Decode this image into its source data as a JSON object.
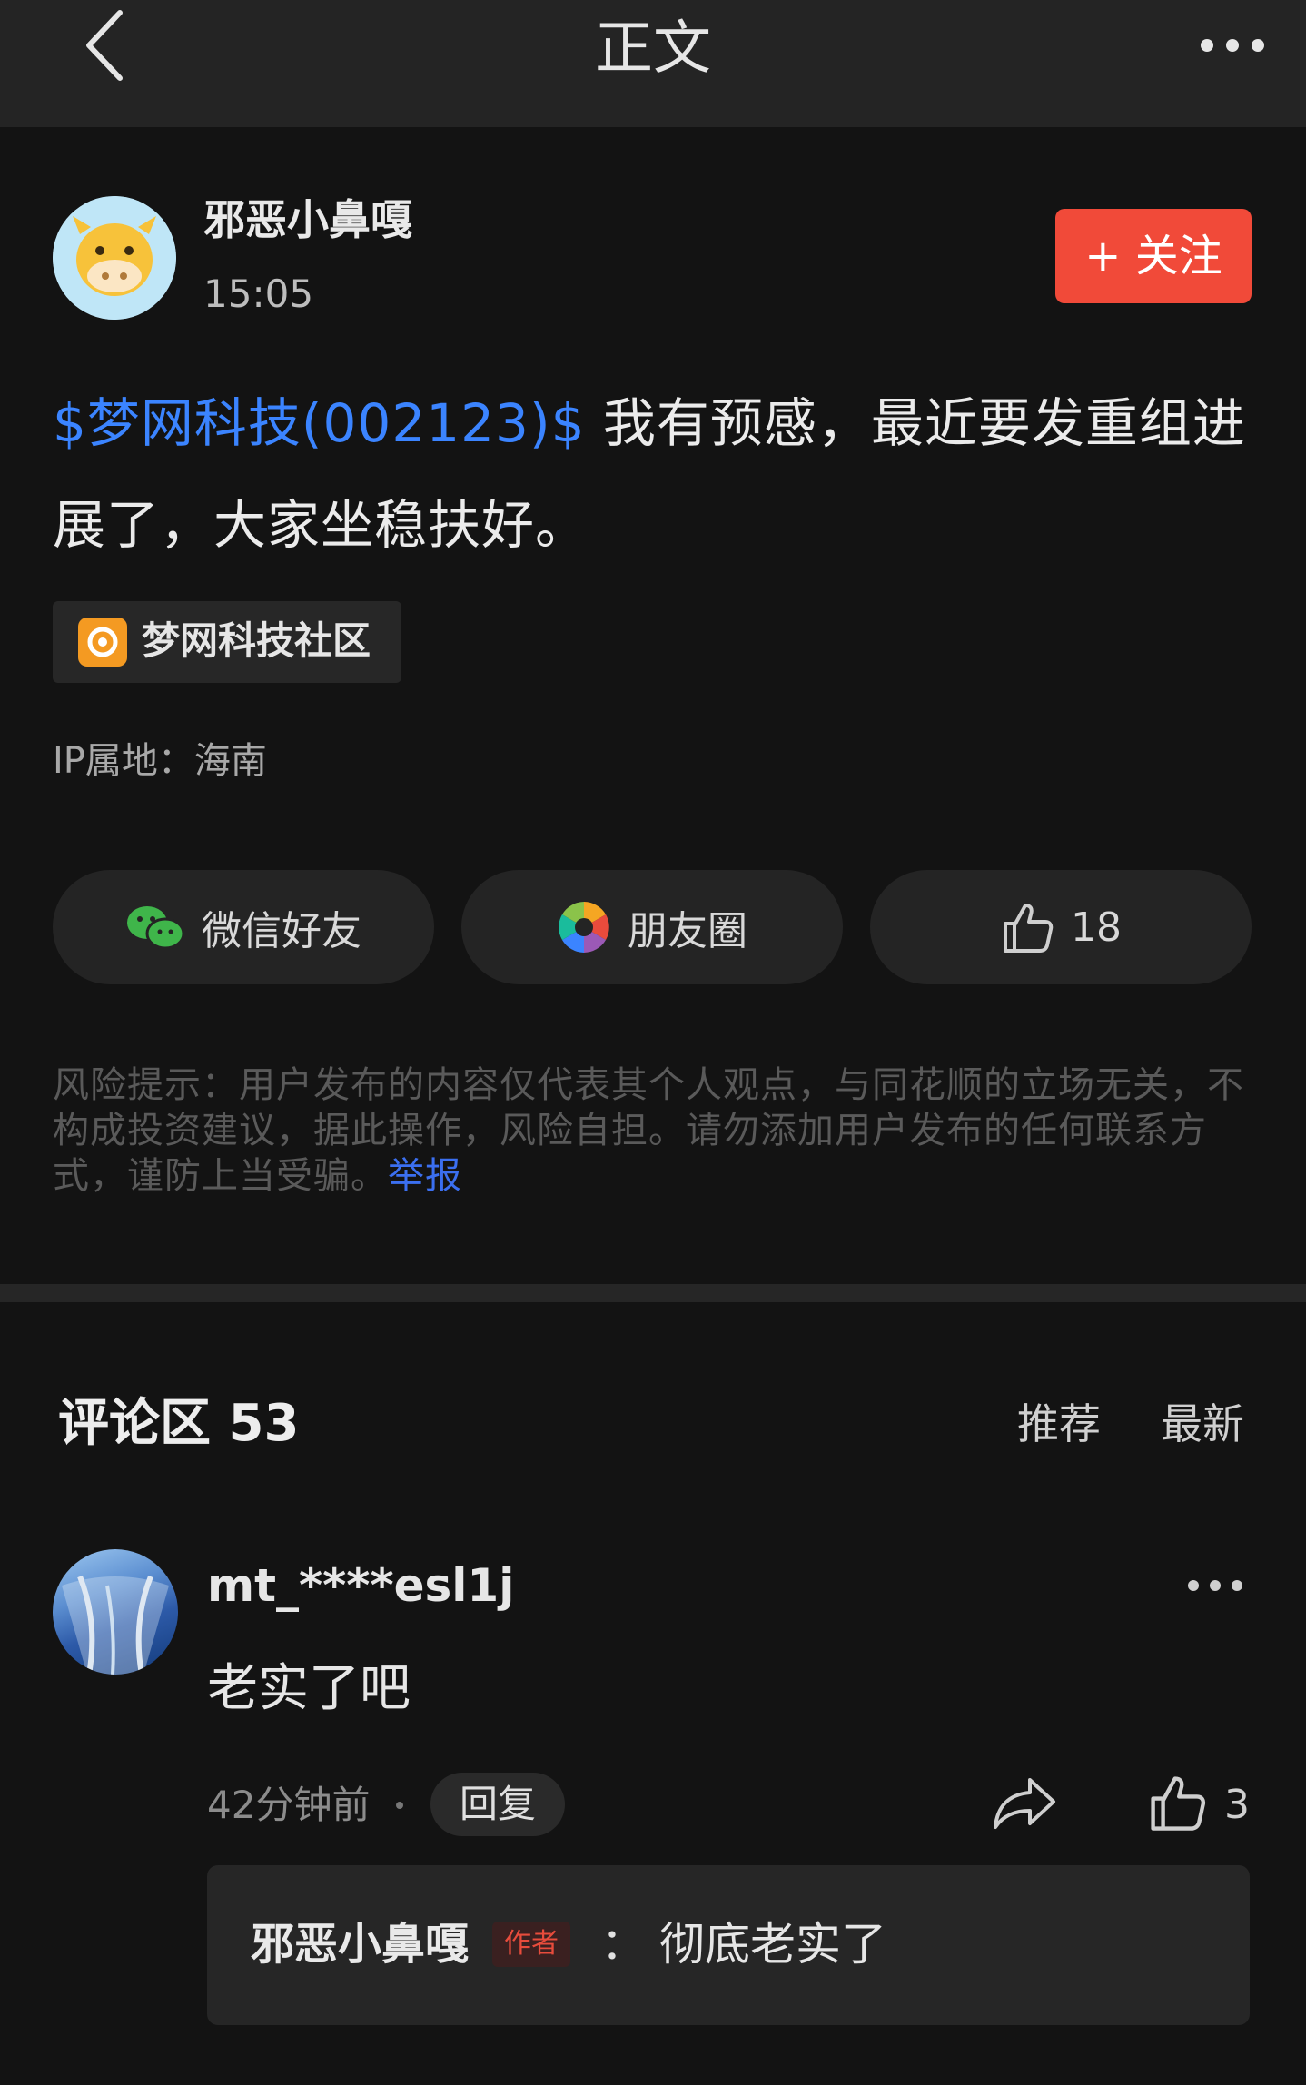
{
  "header": {
    "title": "正文",
    "back_icon": "back-arrow-icon",
    "more_icon": "more-dots-icon"
  },
  "post": {
    "author": "邪恶小鼻嘎",
    "time": "15:05",
    "follow_label": "+ 关注",
    "stock_tag": "$梦网科技(002123)$",
    "text": " 我有预感，最近要发重组进展了，大家坐稳扶好。",
    "community": "梦网科技社区",
    "ip": "IP属地：海南"
  },
  "share": {
    "wechat": "微信好友",
    "moments": "朋友圈",
    "likes": "18"
  },
  "risk": {
    "text": "风险提示：用户发布的内容仅代表其个人观点，与同花顺的立场无关，不构成投资建议，据此操作，风险自担。请勿添加用户发布的任何联系方式，谨防上当受骗。",
    "report_label": "举报"
  },
  "comments": {
    "title": "评论区 53",
    "sort_recommend": "推荐",
    "sort_latest": "最新",
    "items": [
      {
        "user": "mt_****esl1j",
        "text": "老实了吧",
        "time": "42分钟前",
        "reply_label": "回复",
        "likes": "3",
        "reply": {
          "user": "邪恶小鼻嘎",
          "badge": "作者",
          "colon": "：",
          "text": "彻底老实了"
        }
      }
    ]
  },
  "colors": {
    "accent_red": "#f14a39",
    "link_blue": "#3b84ff",
    "bg": "#131313"
  }
}
